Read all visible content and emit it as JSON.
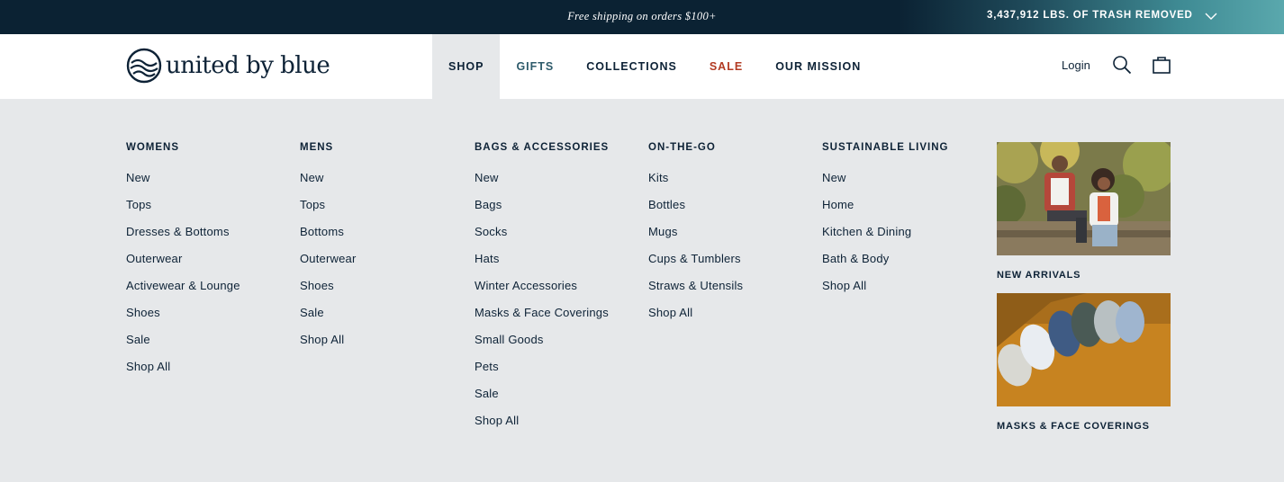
{
  "announcement": {
    "shipping": "Free shipping on orders $100+",
    "trash": "3,437,912 LBS. OF TRASH REMOVED",
    "trash_toggle_icon": "chevron-down-icon"
  },
  "header": {
    "logo_text": "united by blue",
    "nav": [
      {
        "label": "SHOP",
        "active": true
      },
      {
        "label": "GIFTS"
      },
      {
        "label": "COLLECTIONS"
      },
      {
        "label": "SALE",
        "color": "#b23a22"
      },
      {
        "label": "OUR MISSION"
      }
    ],
    "login": "Login",
    "search_icon": "search-icon",
    "cart_icon": "shopping-bag-icon"
  },
  "menu": {
    "columns": [
      {
        "heading": "WOMENS",
        "items": [
          "New",
          "Tops",
          "Dresses & Bottoms",
          "Outerwear",
          "Activewear & Lounge",
          "Shoes",
          "Sale",
          "Shop All"
        ]
      },
      {
        "heading": "MENS",
        "items": [
          "New",
          "Tops",
          "Bottoms",
          "Outerwear",
          "Shoes",
          "Sale",
          "Shop All"
        ]
      },
      {
        "heading": "BAGS & ACCESSORIES",
        "items": [
          "New",
          "Bags",
          "Socks",
          "Hats",
          "Winter Accessories",
          "Masks & Face Coverings",
          "Small Goods",
          "Pets",
          "Sale",
          "Shop All"
        ]
      },
      {
        "heading": "ON-THE-GO",
        "items": [
          "Kits",
          "Bottles",
          "Mugs",
          "Cups & Tumblers",
          "Straws & Utensils",
          "Shop All"
        ]
      },
      {
        "heading": "SUSTAINABLE LIVING",
        "items": [
          "New",
          "Home",
          "Kitchen & Dining",
          "Bath & Body",
          "Shop All"
        ]
      }
    ],
    "promos": [
      {
        "caption": "NEW ARRIVALS"
      },
      {
        "caption": "MASKS & FACE COVERINGS"
      }
    ]
  },
  "colors": {
    "navy": "#0d2236",
    "menu_bg": "#e6e8ea",
    "sale_red": "#b23a22",
    "gifts_teal": "#2e5b6b"
  }
}
